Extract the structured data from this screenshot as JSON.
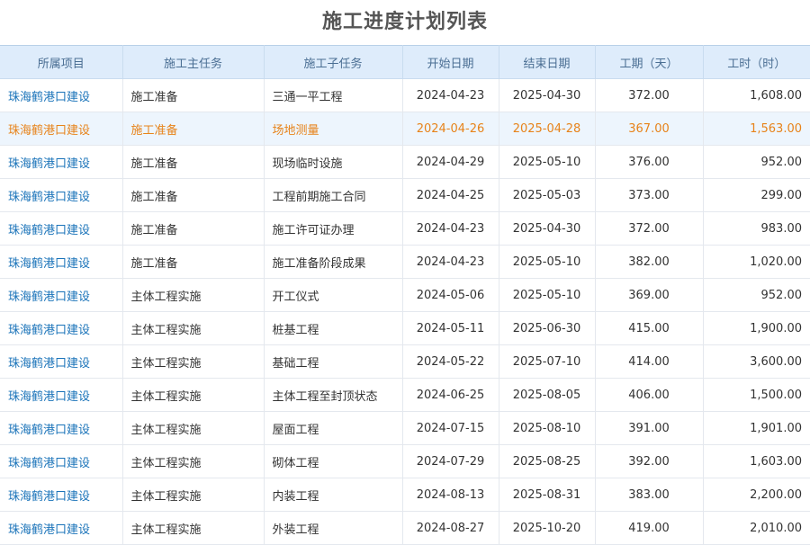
{
  "title": "施工进度计划列表",
  "colors": {
    "header_bg": "#deecfb",
    "link": "#1a73b9",
    "highlight_text": "#e7831a",
    "highlight_bg": "#edf5fd"
  },
  "columns": [
    "所属项目",
    "施工主任务",
    "施工子任务",
    "开始日期",
    "结束日期",
    "工期（天）",
    "工时（时）"
  ],
  "highlighted_row": 1,
  "rows": [
    [
      "珠海鹤港口建设",
      "施工准备",
      "三通一平工程",
      "2024-04-23",
      "2025-04-30",
      "372.00",
      "1,608.00"
    ],
    [
      "珠海鹤港口建设",
      "施工准备",
      "场地测量",
      "2024-04-26",
      "2025-04-28",
      "367.00",
      "1,563.00"
    ],
    [
      "珠海鹤港口建设",
      "施工准备",
      "现场临时设施",
      "2024-04-29",
      "2025-05-10",
      "376.00",
      "952.00"
    ],
    [
      "珠海鹤港口建设",
      "施工准备",
      "工程前期施工合同",
      "2024-04-25",
      "2025-05-03",
      "373.00",
      "299.00"
    ],
    [
      "珠海鹤港口建设",
      "施工准备",
      "施工许可证办理",
      "2024-04-23",
      "2025-04-30",
      "372.00",
      "983.00"
    ],
    [
      "珠海鹤港口建设",
      "施工准备",
      "施工准备阶段成果",
      "2024-04-23",
      "2025-05-10",
      "382.00",
      "1,020.00"
    ],
    [
      "珠海鹤港口建设",
      "主体工程实施",
      "开工仪式",
      "2024-05-06",
      "2025-05-10",
      "369.00",
      "952.00"
    ],
    [
      "珠海鹤港口建设",
      "主体工程实施",
      "桩基工程",
      "2024-05-11",
      "2025-06-30",
      "415.00",
      "1,900.00"
    ],
    [
      "珠海鹤港口建设",
      "主体工程实施",
      "基础工程",
      "2024-05-22",
      "2025-07-10",
      "414.00",
      "3,600.00"
    ],
    [
      "珠海鹤港口建设",
      "主体工程实施",
      "主体工程至封顶状态",
      "2024-06-25",
      "2025-08-05",
      "406.00",
      "1,500.00"
    ],
    [
      "珠海鹤港口建设",
      "主体工程实施",
      "屋面工程",
      "2024-07-15",
      "2025-08-10",
      "391.00",
      "1,901.00"
    ],
    [
      "珠海鹤港口建设",
      "主体工程实施",
      "砌体工程",
      "2024-07-29",
      "2025-08-25",
      "392.00",
      "1,603.00"
    ],
    [
      "珠海鹤港口建设",
      "主体工程实施",
      "内装工程",
      "2024-08-13",
      "2025-08-31",
      "383.00",
      "2,200.00"
    ],
    [
      "珠海鹤港口建设",
      "主体工程实施",
      "外装工程",
      "2024-08-27",
      "2025-10-20",
      "419.00",
      "2,010.00"
    ]
  ]
}
